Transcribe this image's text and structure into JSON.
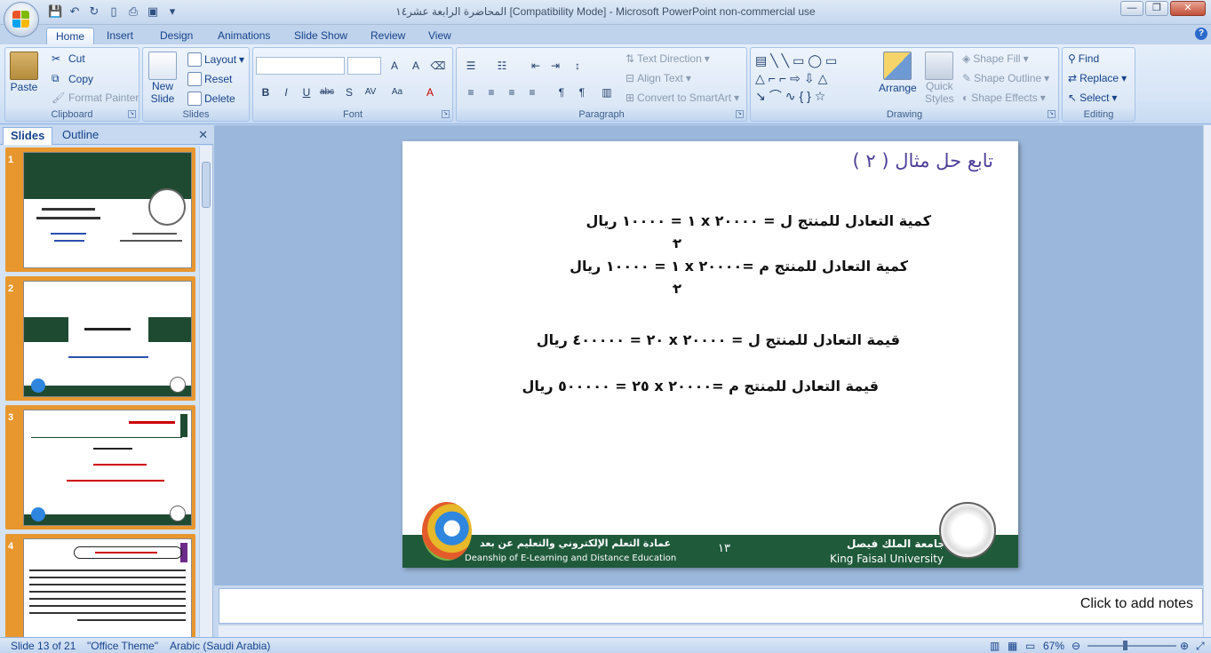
{
  "window": {
    "title": "المحاضرة الرابعة عشر١٤ [Compatibility Mode] - Microsoft PowerPoint non-commercial use",
    "buttons": [
      "—",
      "❐",
      "✕"
    ]
  },
  "tabs": [
    "Home",
    "Insert",
    "Design",
    "Animations",
    "Slide Show",
    "Review",
    "View"
  ],
  "ribbon": {
    "clipboard": {
      "label": "Clipboard",
      "paste": "Paste",
      "cut": "Cut",
      "copy": "Copy",
      "format_painter": "Format Painter"
    },
    "slides": {
      "label": "Slides",
      "new_slide": "New",
      "new_slide2": "Slide",
      "layout": "Layout",
      "reset": "Reset",
      "delete": "Delete"
    },
    "font": {
      "label": "Font"
    },
    "paragraph": {
      "label": "Paragraph",
      "text_direction": "Text Direction",
      "align_text": "Align Text",
      "convert": "Convert to SmartArt"
    },
    "drawing": {
      "label": "Drawing",
      "arrange": "Arrange",
      "quick_styles": "Quick",
      "quick_styles2": "Styles",
      "shape_fill": "Shape Fill",
      "shape_outline": "Shape Outline",
      "shape_effects": "Shape Effects"
    },
    "editing": {
      "label": "Editing",
      "find": "Find",
      "replace": "Replace",
      "select": "Select"
    }
  },
  "pane": {
    "tabs": [
      "Slides",
      "Outline"
    ],
    "thumbnails": [
      {
        "num": "1"
      },
      {
        "num": "2"
      },
      {
        "num": "3"
      },
      {
        "num": "4"
      }
    ]
  },
  "slide": {
    "title": "تابع حل مثال  ( ٢ )",
    "lines": [
      "كمية التعادل للمنتج  ل =     ٢٠٠٠٠ x ١  =  ١٠٠٠٠ ريال",
      "كمية التعادل للمنتج  م =٢٠٠٠٠ x ١  =  ١٠٠٠٠ ريال",
      "قيمة التعادل للمنتج  ل =     ٢٠٠٠٠ x ٢٠        =  ٤٠٠٠٠٠ ريال",
      "قيمة التعادل للمنتج   م =٢٠٠٠٠    x   ٢٥  =  ٥٠٠٠٠٠ ريال"
    ],
    "denominator": "٢",
    "footer": {
      "dept_ar": "عمادة التعلم الإلكتروني والتعليم عن بعد",
      "dept_en": "Deanship of E-Learning and Distance Education",
      "page": "١٣",
      "univ_ar": "جامعة الملك فيصل",
      "univ_en": "King Faisal University"
    }
  },
  "notes_placeholder": "Click to add notes",
  "status": {
    "slide": "Slide 13 of 21",
    "theme": "\"Office Theme\"",
    "language": "Arabic (Saudi Arabia)",
    "zoom": "67%"
  },
  "colors": {
    "footer_green": "#1f5a3b",
    "title_purple": "#4f3f9a",
    "selected_thumb": "#f6c173"
  }
}
